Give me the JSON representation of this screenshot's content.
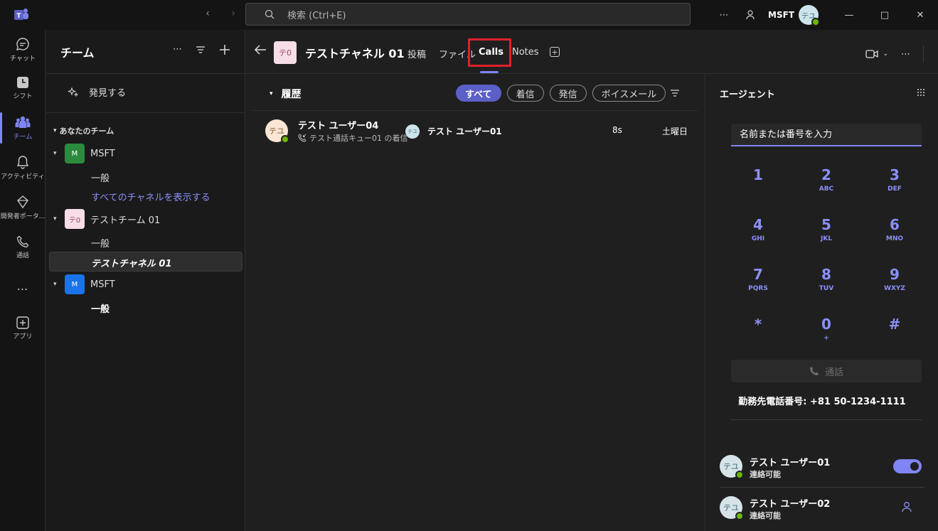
{
  "titlebar": {
    "search_placeholder": "検索 (Ctrl+E)",
    "org": "MSFT",
    "avatar_initials": "テユ"
  },
  "rail": {
    "items": [
      {
        "label": "チャット",
        "icon": "chat-icon"
      },
      {
        "label": "シフト",
        "icon": "clock-icon"
      },
      {
        "label": "チーム",
        "icon": "teams-icon",
        "active": true
      },
      {
        "label": "アクティビティ",
        "icon": "bell-icon"
      },
      {
        "label": "開発者ポータ...",
        "icon": "portal-icon"
      },
      {
        "label": "通話",
        "icon": "phone-icon"
      },
      {
        "label": "アプリ",
        "icon": "add-app-icon"
      }
    ]
  },
  "teams_panel": {
    "title": "チーム",
    "discover": "発見する",
    "section": "あなたのチーム",
    "teams": [
      {
        "initials": "M",
        "name": "MSFT",
        "color": "#2b8a3e",
        "channels": [
          "一般",
          "すべてのチャネルを表示する"
        ]
      },
      {
        "initials": "テ0",
        "name": "テストチーム 01",
        "color": "#f6dde8",
        "channels": [
          "一般",
          "テストチャネル 01"
        ]
      },
      {
        "initials": "M",
        "name": "MSFT",
        "color": "#1a73e8",
        "channels": [
          "一般"
        ]
      }
    ]
  },
  "channel_header": {
    "avatar": "テ0",
    "name": "テストチャネル 01",
    "tabs": [
      "投稿",
      "ファイル",
      "Calls",
      "Notes"
    ],
    "active_tab": "Calls"
  },
  "history": {
    "title": "履歴",
    "filters": [
      "すべて",
      "着信",
      "発信",
      "ボイスメール"
    ],
    "selected_filter": "すべて",
    "calls": [
      {
        "caller_initials": "テユ",
        "caller": "テスト ユーザー04",
        "detail": "テスト通話キュー01 の着信",
        "agent_initials": "テユ",
        "agent": "テスト ユーザー01",
        "duration": "8s",
        "day": "土曜日"
      }
    ]
  },
  "agent_panel": {
    "title": "エージェント",
    "input_placeholder": "名前または番号を入力",
    "keys": [
      {
        "d": "1",
        "s": ""
      },
      {
        "d": "2",
        "s": "ABC"
      },
      {
        "d": "3",
        "s": "DEF"
      },
      {
        "d": "4",
        "s": "GHI"
      },
      {
        "d": "5",
        "s": "JKL"
      },
      {
        "d": "6",
        "s": "MNO"
      },
      {
        "d": "7",
        "s": "PQRS"
      },
      {
        "d": "8",
        "s": "TUV"
      },
      {
        "d": "9",
        "s": "WXYZ"
      },
      {
        "d": "*",
        "s": ""
      },
      {
        "d": "0",
        "s": "+"
      },
      {
        "d": "#",
        "s": ""
      }
    ],
    "call_label": "通話",
    "work_number": "勤務先電話番号: +81 50-1234-1111",
    "agents": [
      {
        "initials": "テユ",
        "name": "テスト ユーザー01",
        "status": "連絡可能",
        "toggle_on": true
      },
      {
        "initials": "テユ",
        "name": "テスト ユーザー02",
        "status": "連絡可能"
      }
    ]
  }
}
